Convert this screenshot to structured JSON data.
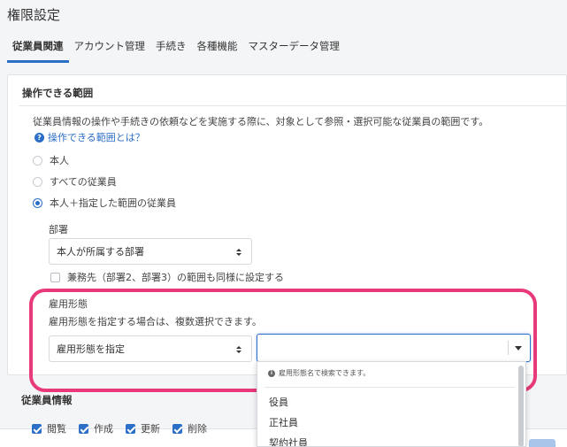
{
  "page": {
    "title": "権限設定"
  },
  "tabs": [
    {
      "label": "従業員関連",
      "active": true
    },
    {
      "label": "アカウント管理",
      "active": false
    },
    {
      "label": "手続き",
      "active": false
    },
    {
      "label": "各種機能",
      "active": false
    },
    {
      "label": "マスターデータ管理",
      "active": false
    }
  ],
  "scope": {
    "title": "操作できる範囲",
    "description": "従業員情報の操作や手続きの依頼などを実施する際に、対象として参照・選択可能な従業員の範囲です。",
    "help_link": "操作できる範囲とは？",
    "options": [
      {
        "label": "本人",
        "checked": false
      },
      {
        "label": "すべての従業員",
        "checked": false
      },
      {
        "label": "本人＋指定した範囲の従業員",
        "checked": true
      }
    ],
    "department": {
      "label": "部署",
      "selected": "本人が所属する部署",
      "concurrent_label": "兼務先（部署2、部署3）の範囲も同様に設定する",
      "concurrent_checked": false
    },
    "employment": {
      "label": "雇用形態",
      "hint": "雇用形態を指定する場合は、複数選択できます。",
      "selected": "雇用形態を指定",
      "search_value": "",
      "dropdown_hint": "雇用形態名で検索できます。",
      "options": [
        "役員",
        "正社員",
        "契約社員"
      ]
    }
  },
  "employee_info": {
    "title": "従業員情報",
    "permissions": [
      {
        "label": "閲覧",
        "checked": true
      },
      {
        "label": "作成",
        "checked": true
      },
      {
        "label": "更新",
        "checked": true
      },
      {
        "label": "削除",
        "checked": true
      }
    ]
  },
  "colors": {
    "accent": "#2c6fc7",
    "highlight": "#e8397a"
  }
}
